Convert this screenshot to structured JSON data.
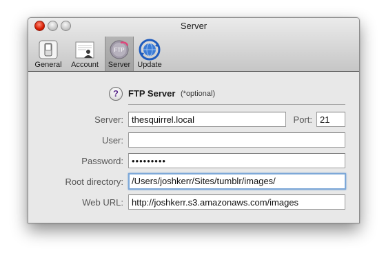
{
  "window": {
    "title": "Server"
  },
  "toolbar": {
    "items": [
      {
        "label": "General",
        "icon": "switch-icon",
        "selected": false
      },
      {
        "label": "Account",
        "icon": "account-card-icon",
        "selected": false
      },
      {
        "label": "Server",
        "icon": "ftp-server-icon",
        "selected": true
      },
      {
        "label": "Update",
        "icon": "update-globe-icon",
        "selected": false
      }
    ]
  },
  "section": {
    "help_symbol": "?",
    "title": "FTP Server",
    "note": "(*optional)"
  },
  "form": {
    "server_label": "Server:",
    "server_value": "thesquirrel.local",
    "port_label": "Port:",
    "port_value": "21",
    "user_label": "User:",
    "user_value": "",
    "password_label": "Password:",
    "password_value": "•••••••••",
    "root_label": "Root directory:",
    "root_value": "/Users/joshkerr/Sites/tumblr/images/",
    "weburl_label": "Web URL:",
    "weburl_value": "http://joshkerr.s3.amazonaws.com/images"
  },
  "colors": {
    "close_button": "#d81c00",
    "focus_ring": "#7da8d8",
    "help_glyph": "#5a2a8a"
  }
}
